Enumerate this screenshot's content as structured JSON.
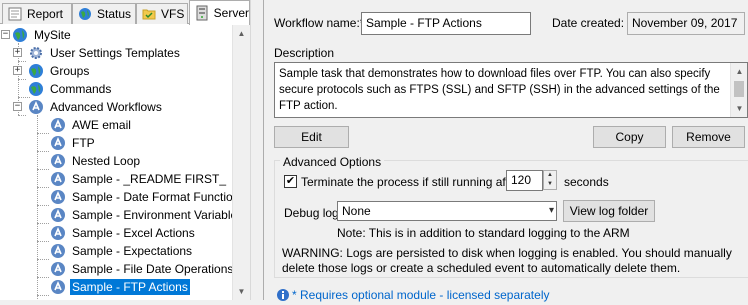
{
  "tabs": [
    {
      "label": "Report",
      "icon": "report-icon"
    },
    {
      "label": "Status",
      "icon": "status-globe-icon"
    },
    {
      "label": "VFS",
      "icon": "vfs-folder-icon"
    },
    {
      "label": "Server",
      "icon": "server-icon",
      "active": true
    }
  ],
  "tree": {
    "root": "MySite",
    "items": [
      {
        "label": "User Settings Templates",
        "icon": "gear-icon"
      },
      {
        "label": "Groups",
        "icon": "globe-icon"
      },
      {
        "label": "Commands",
        "icon": "globe-icon"
      },
      {
        "label": "Advanced Workflows",
        "icon": "workflow-icon"
      }
    ],
    "workflows": [
      "AWE email",
      "FTP",
      "Nested Loop",
      "Sample - _README FIRST_",
      "Sample - Date Format Functions",
      "Sample - Environment Variables",
      "Sample - Excel Actions",
      "Sample - Expectations",
      "Sample - File Date Operations",
      "Sample - FTP Actions"
    ],
    "selected": "Sample - FTP Actions"
  },
  "form": {
    "workflow_name_label": "Workflow name:*",
    "workflow_name_value": "Sample - FTP Actions",
    "date_created_label": "Date created:",
    "date_created_value": "November 09, 2017",
    "description_label": "Description",
    "description_text": "Sample task that demonstrates how to download files over FTP. You can also specify secure protocols such as FTPS (SSL) and SFTP (SSH) in the advanced settings of the FTP action.\n\nEven though EFT Server includes an FTP offload and download action as part of its built-in",
    "edit_button": "Edit",
    "copy_button": "Copy",
    "remove_button": "Remove"
  },
  "advanced": {
    "group_label": "Advanced Options",
    "terminate_checked": true,
    "terminate_label": "Terminate the process if still running after",
    "terminate_value": "120",
    "seconds_label": "seconds",
    "debug_log_label": "Debug log:",
    "debug_log_value": "None",
    "view_log_button": "View log folder",
    "note": "Note: This is in addition to standard logging to the ARM",
    "warning": "WARNING: Logs are persisted to disk when logging is enabled. You should manually delete those logs or create a scheduled event to automatically delete them."
  },
  "footer_note": "* Requires optional module - licensed separately",
  "colors": {
    "selection": "#0078d7",
    "link": "#0066cc"
  }
}
